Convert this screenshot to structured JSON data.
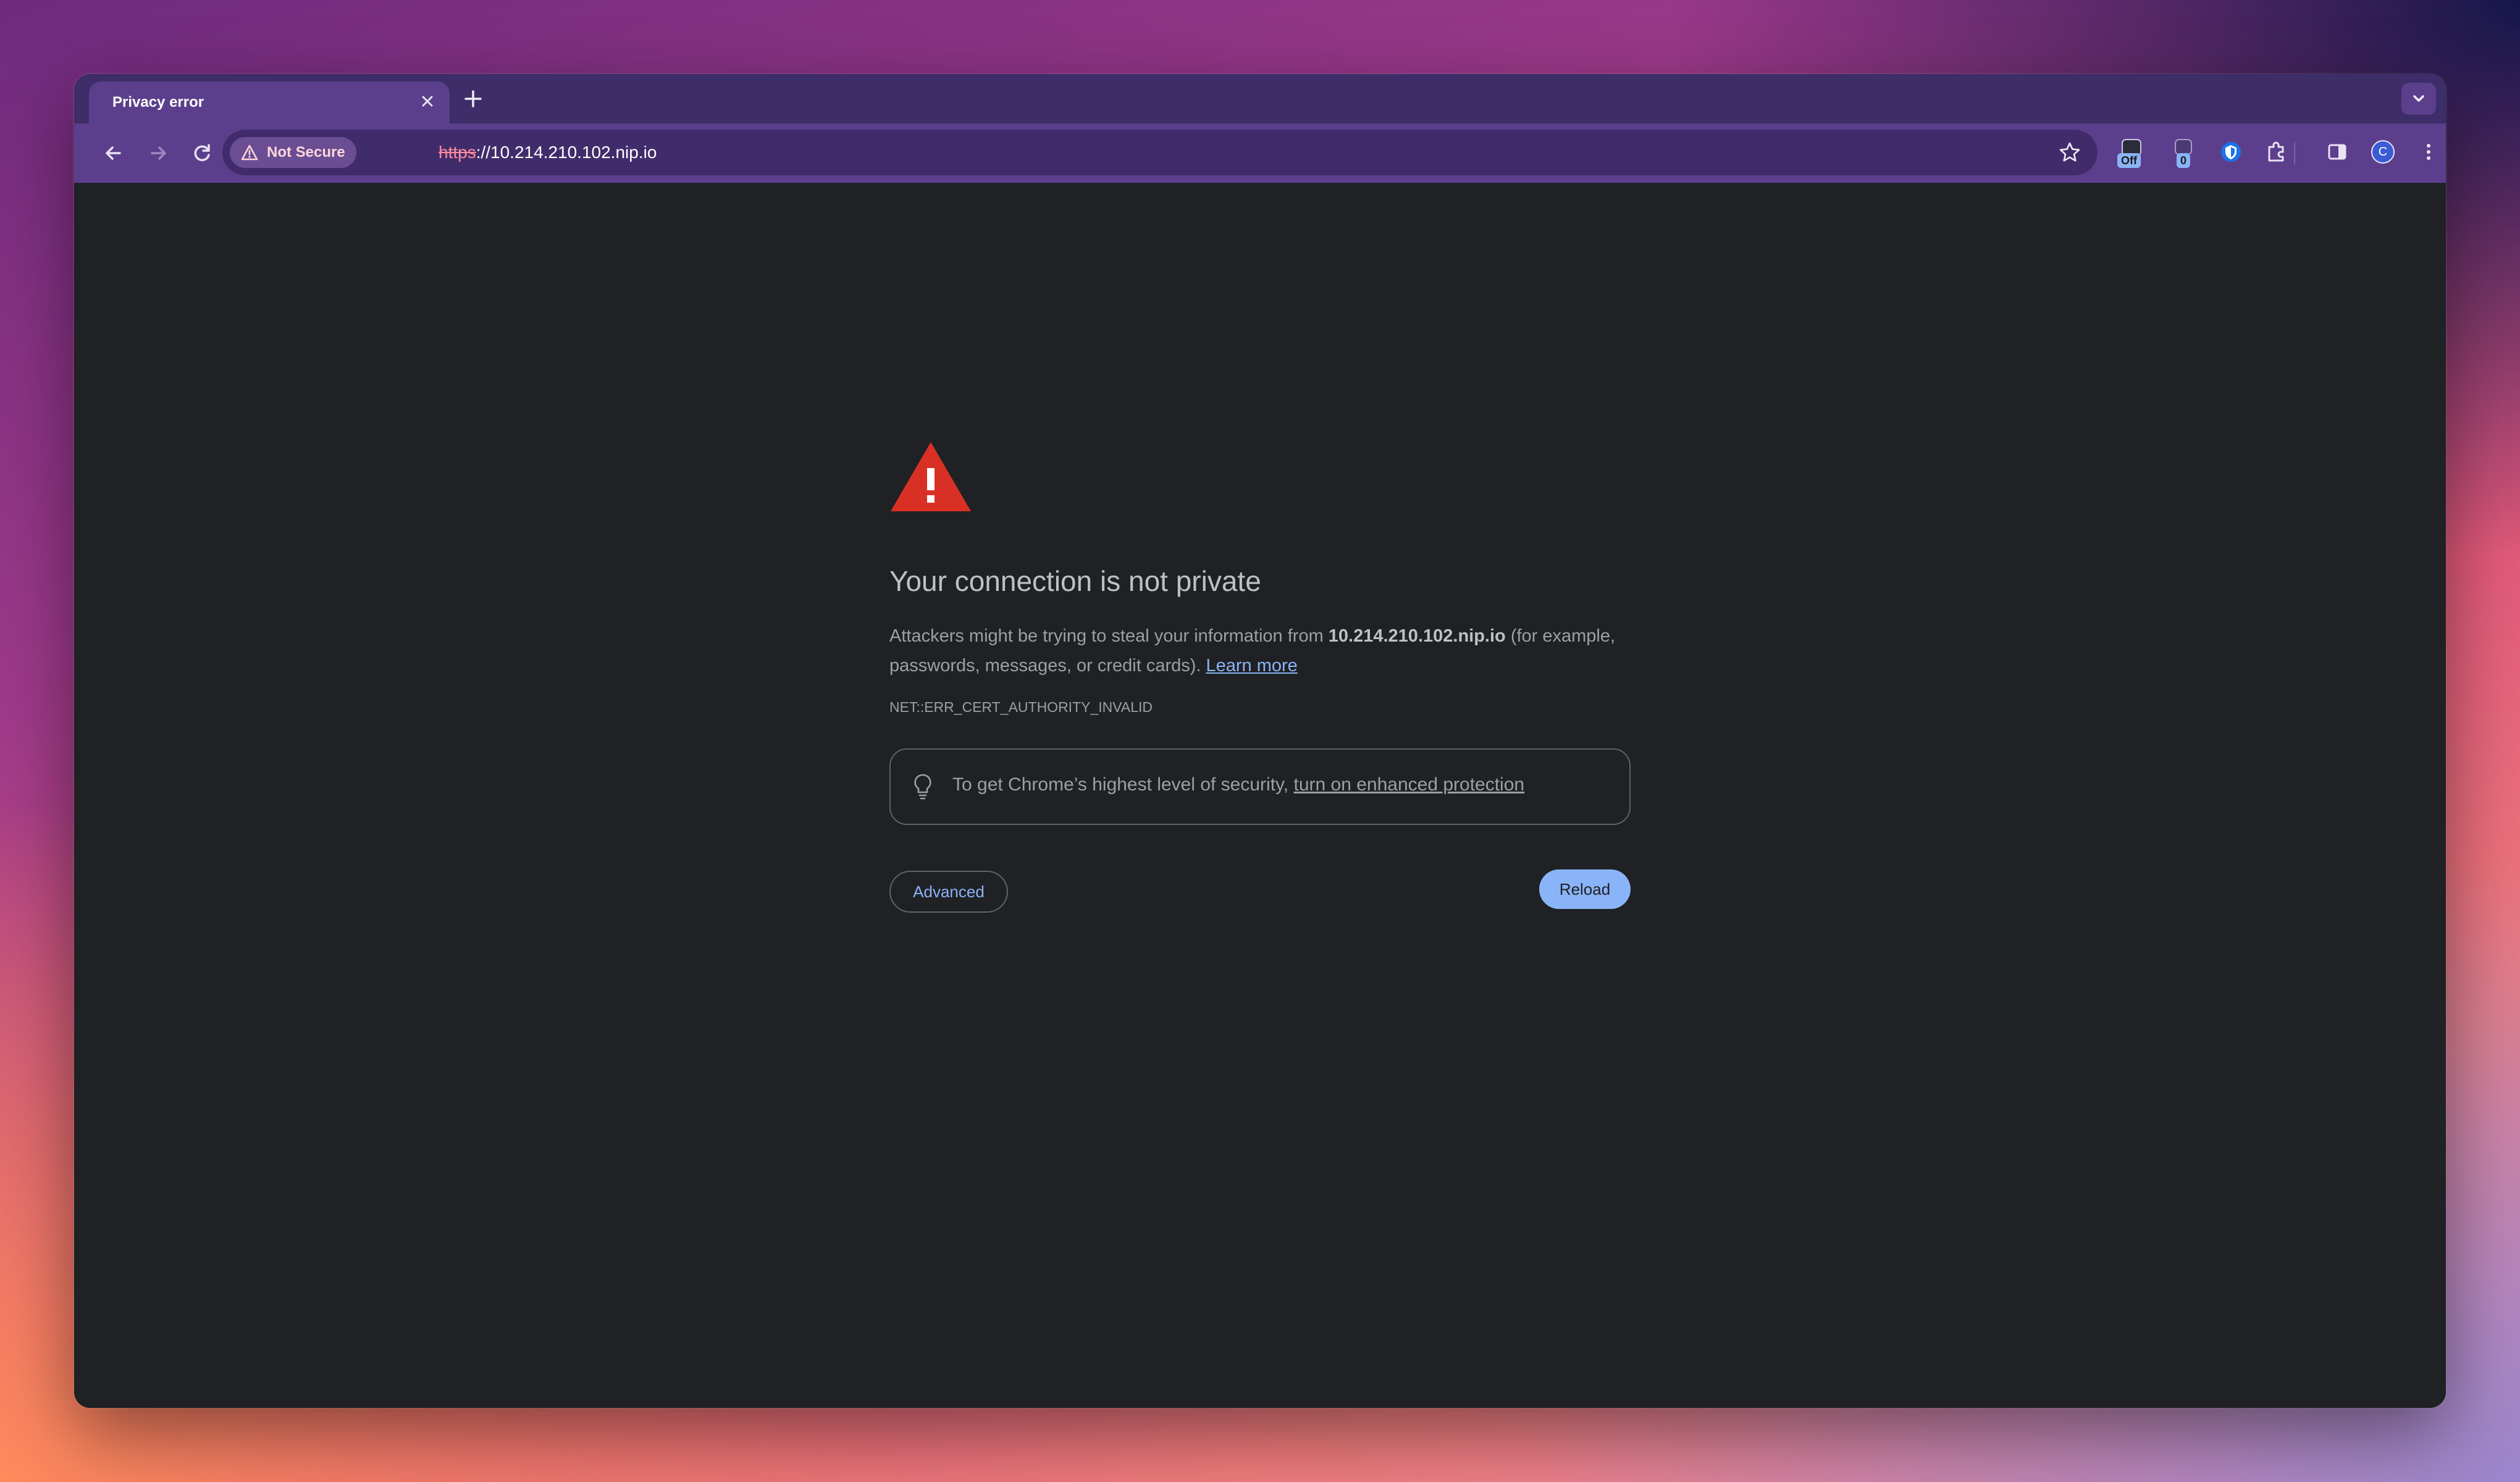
{
  "tab": {
    "title": "Privacy error",
    "close_icon": "close-icon",
    "new_tab_icon": "plus-icon"
  },
  "toolbar": {
    "security_chip": "Not Secure",
    "url_scheme": "https",
    "url_rest": "://10.214.210.102.nip.io",
    "extension_badges": [
      "Off",
      "0"
    ],
    "profile_initial": "C"
  },
  "page": {
    "heading": "Your connection is not private",
    "body_prefix": "Attackers might be trying to steal your information from ",
    "domain": "10.214.210.102.nip.io",
    "body_suffix": " (for example, passwords, messages, or credit cards). ",
    "learn_more": "Learn more",
    "error_code": "NET::ERR_CERT_AUTHORITY_INVALID",
    "security_tip": "To get Chrome’s highest level of security, ",
    "security_link": "turn on enhanced protection",
    "advanced_label": "Advanced",
    "reload_label": "Reload"
  },
  "colors": {
    "warning_red": "#d93025",
    "link_blue": "#8ab4f8",
    "frame_purple": "#5b3f8c",
    "page_bg": "#202124"
  }
}
